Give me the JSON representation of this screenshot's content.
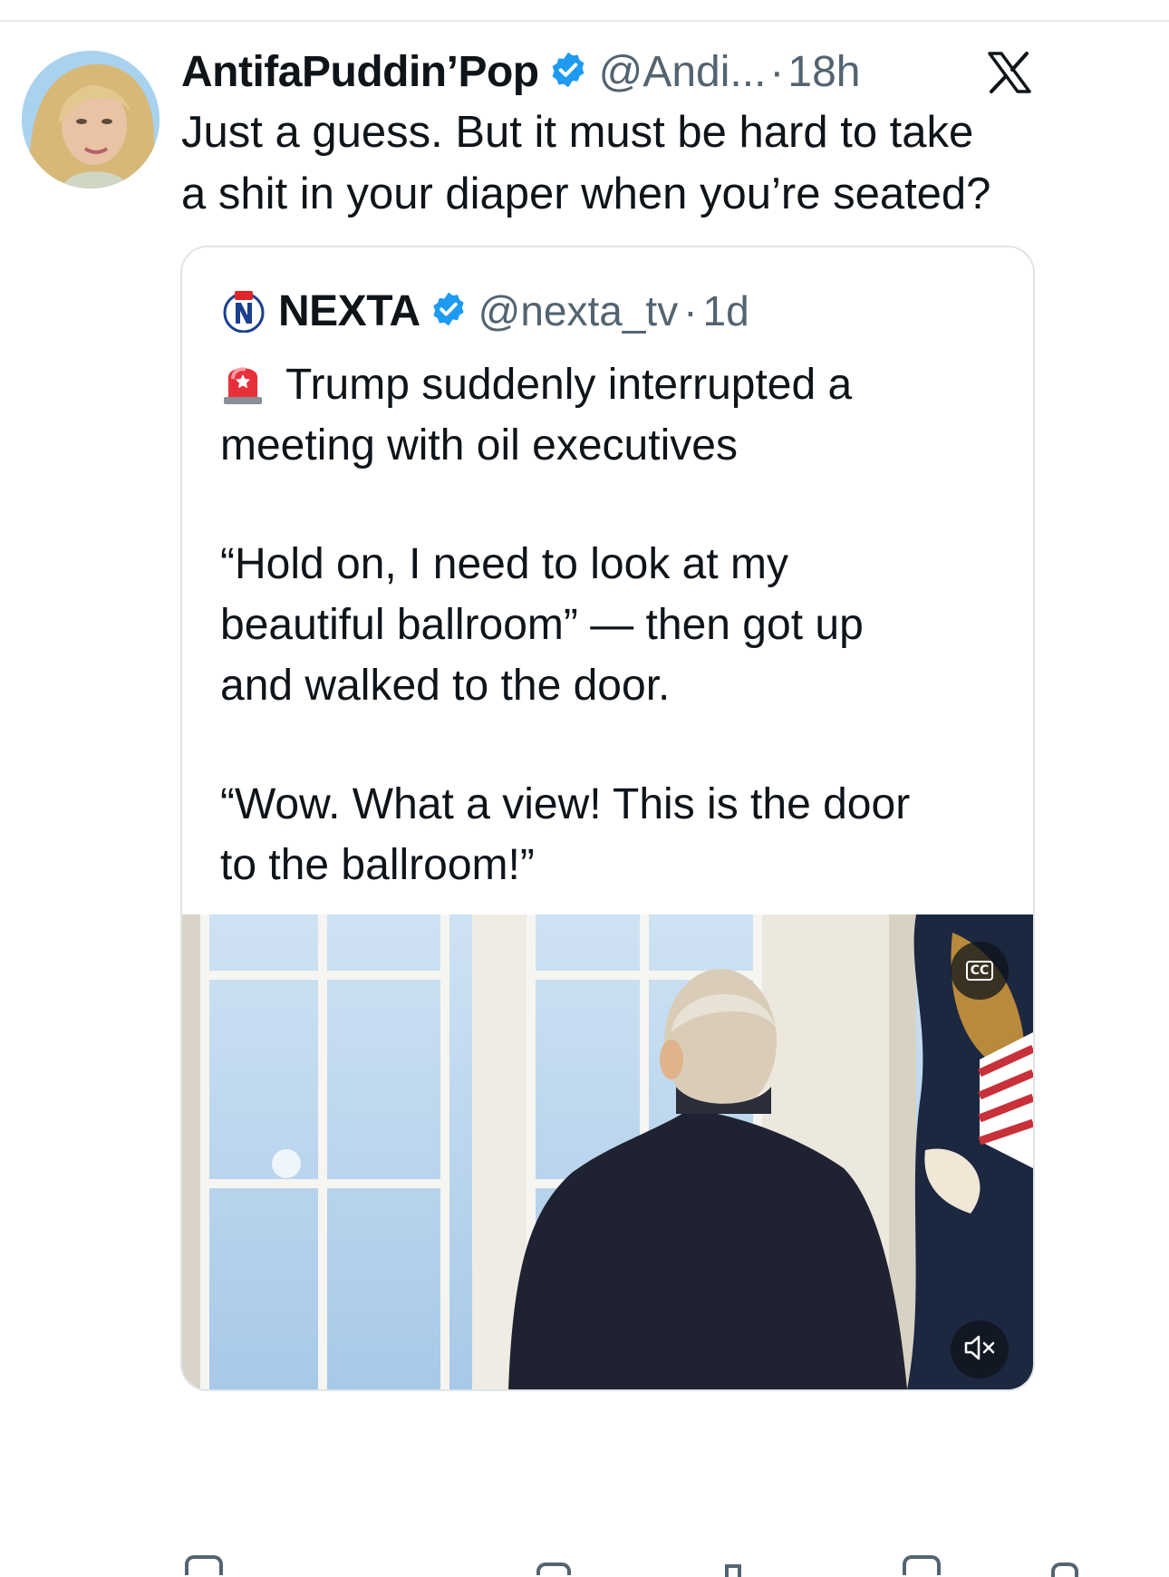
{
  "tweet": {
    "display_name": "AntifaPuddin’Pop",
    "handle": "@Andi...",
    "separator": "·",
    "time": "18h",
    "text_lines": [
      "Just a guess. But it must be hard to take",
      "a shit in your diaper when you’re seated?"
    ]
  },
  "quote": {
    "display_name": "NEXTA",
    "handle": "@nexta_tv",
    "separator": "·",
    "time": "1d",
    "paragraphs": [
      [
        "Trump suddenly interrupted a",
        "meeting with oil executives"
      ],
      [
        "“Hold on, I need to look at my",
        "beautiful ballroom” — then got up",
        "and walked to the door."
      ],
      [
        "“Wow. What a view! This is the door",
        "to the ballroom!”"
      ]
    ],
    "media": {
      "cc_label": "CC",
      "mute_icon": "speaker-muted-icon"
    }
  },
  "colors": {
    "verified": "#1d9bf0",
    "secondary_text": "#536471",
    "border": "#e1e5e8"
  }
}
